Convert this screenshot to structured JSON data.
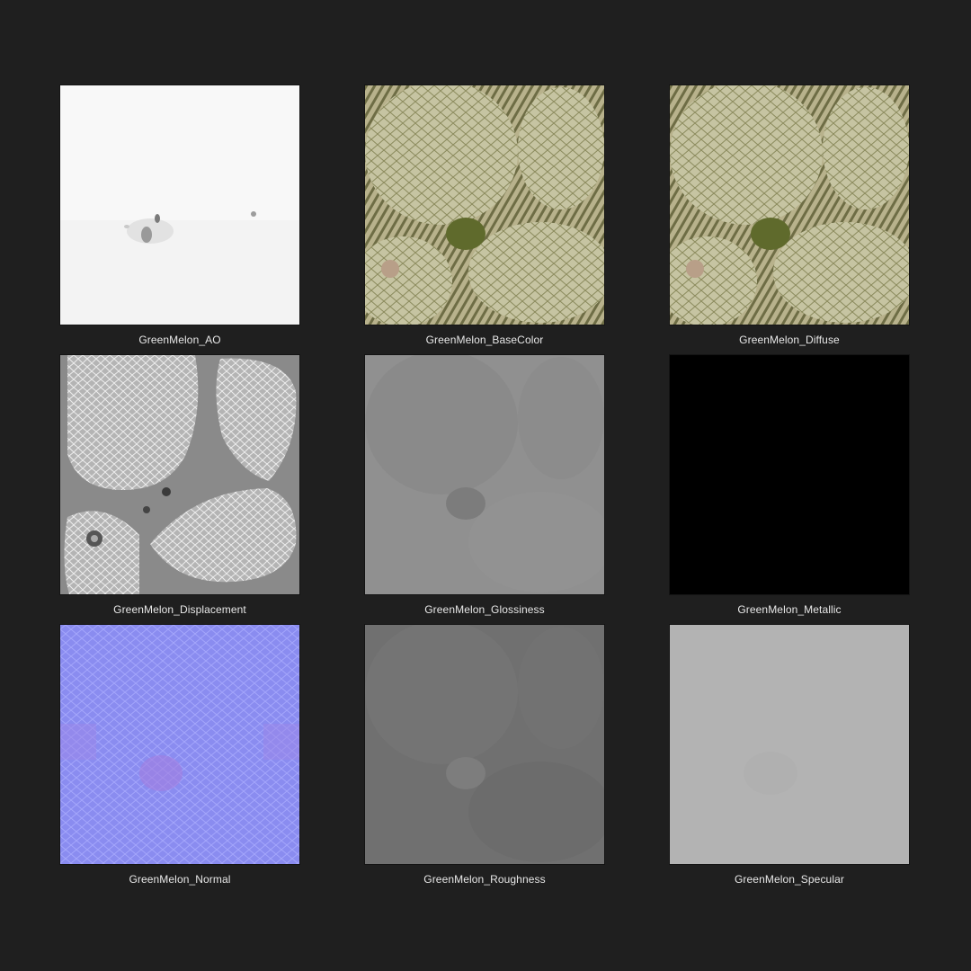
{
  "textures": [
    {
      "label": "GreenMelon_AO",
      "kind": "ao"
    },
    {
      "label": "GreenMelon_BaseColor",
      "kind": "basecolor"
    },
    {
      "label": "GreenMelon_Diffuse",
      "kind": "diffuse"
    },
    {
      "label": "GreenMelon_Displacement",
      "kind": "displacement"
    },
    {
      "label": "GreenMelon_Glossiness",
      "kind": "glossiness"
    },
    {
      "label": "GreenMelon_Metallic",
      "kind": "metallic"
    },
    {
      "label": "GreenMelon_Normal",
      "kind": "normal"
    },
    {
      "label": "GreenMelon_Roughness",
      "kind": "roughness"
    },
    {
      "label": "GreenMelon_Specular",
      "kind": "specular"
    }
  ],
  "colors": {
    "background": "#1f1f1f",
    "caption_text": "#e8e8e8",
    "ao": "#f7f7f7",
    "basecolor_light": "#c9c8a6",
    "basecolor_dark": "#6d6f3c",
    "displacement": "#8c8c8c",
    "glossiness": "#8f8f8f",
    "metallic": "#000000",
    "normal": "#8a8cf0",
    "roughness": "#6f6f6f",
    "specular": "#b3b3b3"
  }
}
